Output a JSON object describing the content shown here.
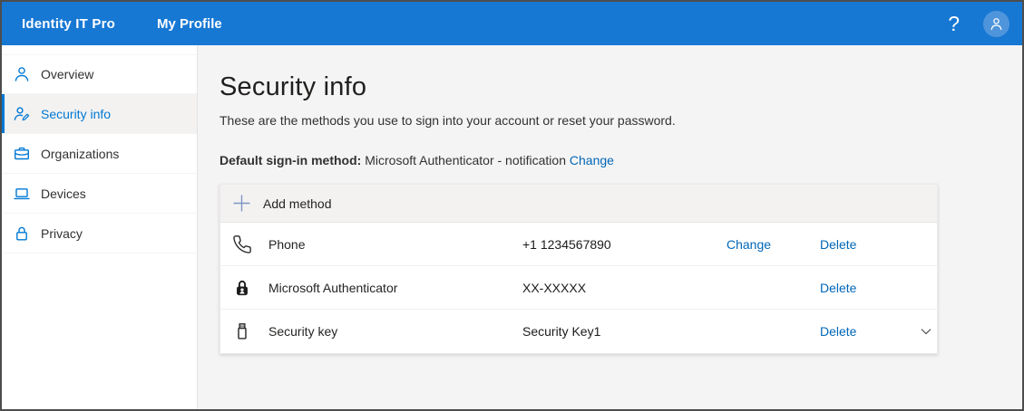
{
  "topbar": {
    "brand": "Identity IT Pro",
    "nav": "My Profile",
    "help_icon": "?",
    "avatar_icon": "person-avatar-icon",
    "bg_color": "#1778d4",
    "avatar_bg_color": "#4f95db"
  },
  "sidebar": {
    "items": [
      {
        "label": "Overview",
        "icon": "person-icon",
        "selected": false
      },
      {
        "label": "Security info",
        "icon": "person-edit-icon",
        "selected": true
      },
      {
        "label": "Organizations",
        "icon": "briefcase-icon",
        "selected": false
      },
      {
        "label": "Devices",
        "icon": "laptop-icon",
        "selected": false
      },
      {
        "label": "Privacy",
        "icon": "padlock-icon",
        "selected": false
      }
    ],
    "selected_color": "#0078d4",
    "icon_color": "#0078d4"
  },
  "main": {
    "title": "Security info",
    "subtitle": "These are the methods you use to sign into your account or reset your password.",
    "default_method": {
      "label": "Default sign-in method:",
      "value": "Microsoft Authenticator - notification",
      "change_link": "Change"
    },
    "add_method_label": "Add method",
    "add_icon": "plus-icon",
    "methods": [
      {
        "name": "Phone",
        "detail": "+1 1234567890",
        "icon": "phone-icon",
        "actions": {
          "change": "Change",
          "delete": "Delete"
        },
        "expandable": false
      },
      {
        "name": "Microsoft Authenticator",
        "detail": "XX-XXXXX",
        "icon": "authenticator-lock-icon",
        "actions": {
          "delete": "Delete"
        },
        "expandable": false
      },
      {
        "name": "Security key",
        "detail": "Security Key1",
        "icon": "usb-security-key-icon",
        "actions": {
          "delete": "Delete"
        },
        "expandable": true,
        "expand_icon": "chevron-down-icon"
      }
    ]
  },
  "colors": {
    "link": "#0067b8",
    "main_bg": "#f5f4f4",
    "add_row_bg": "#f3f2f1",
    "plus_icon": "#7e96c5",
    "dark_icon": "#2b2a29"
  }
}
